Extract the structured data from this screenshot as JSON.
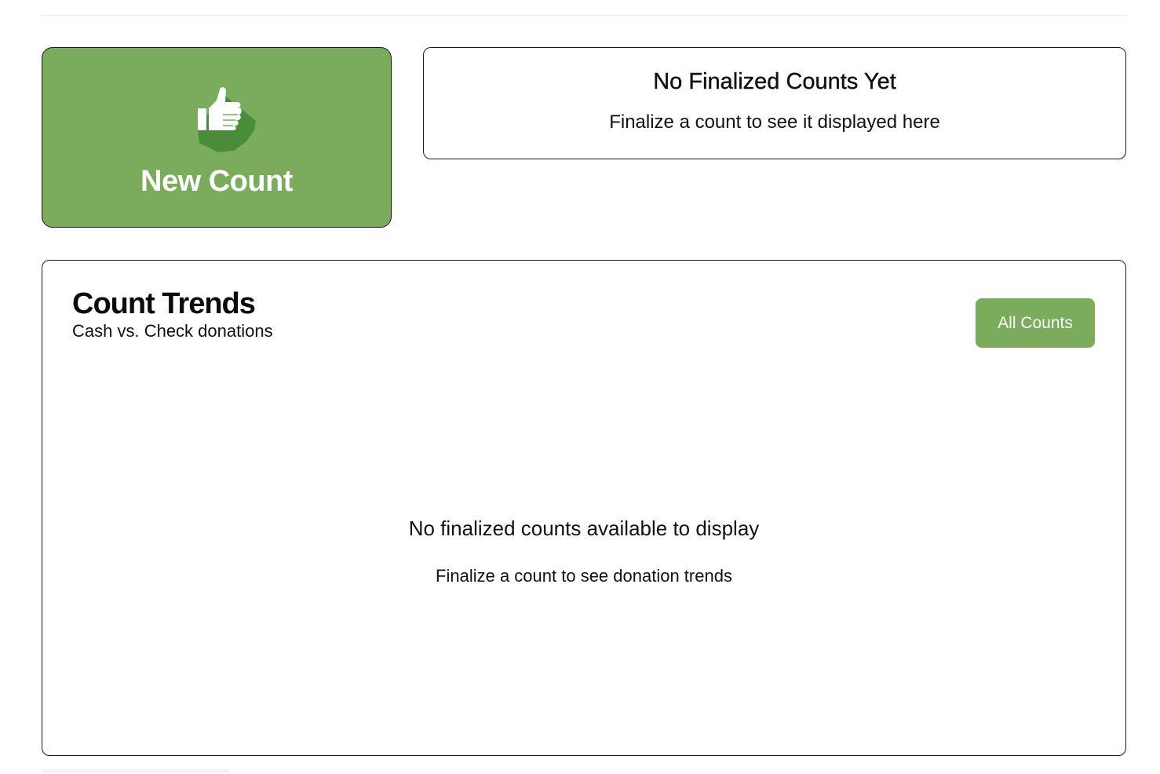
{
  "new_count_card": {
    "label": "New Count",
    "icon": "thumbs-up-icon",
    "background_color": "#7aac5c",
    "icon_shadow_color": "#4a8c3a"
  },
  "latest_count_card": {
    "title": "No Finalized Counts Yet",
    "subtitle": "Finalize a count to see it displayed here"
  },
  "count_trends": {
    "title": "Count Trends",
    "subtitle": "Cash vs. Check donations",
    "all_counts_button": "All Counts",
    "empty_title": "No finalized counts available to display",
    "empty_subtitle": "Finalize a count to see donation trends"
  },
  "colors": {
    "accent_green": "#7aac5c",
    "border": "#1a1a1a",
    "text": "#111111"
  }
}
